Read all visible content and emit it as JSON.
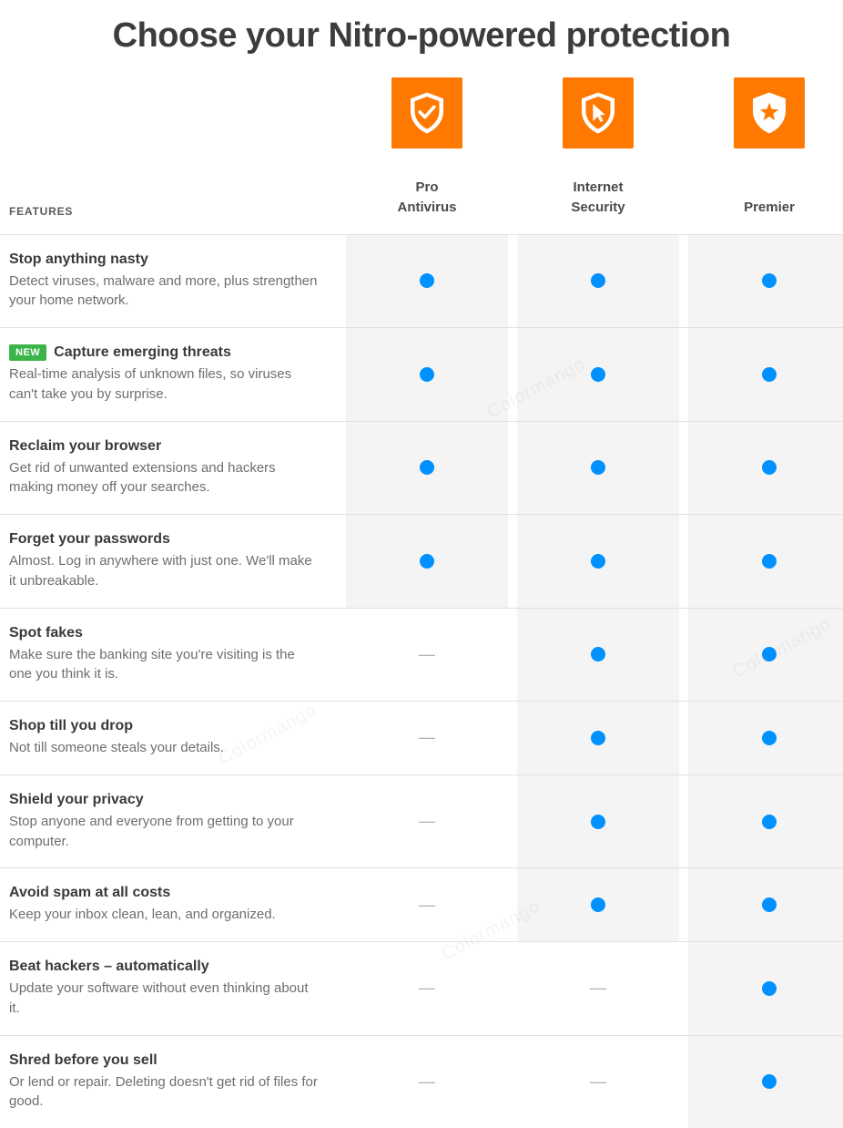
{
  "title": "Choose your Nitro-powered protection",
  "features_header": "FEATURES",
  "watermark_text": "Colormango",
  "new_badge": "NEW",
  "plans": [
    {
      "id": "pro",
      "name_line1": "Pro",
      "name_line2": "Antivirus",
      "icon": "shield-check"
    },
    {
      "id": "internet",
      "name_line1": "Internet",
      "name_line2": "Security",
      "icon": "shield-cursor"
    },
    {
      "id": "premier",
      "name_line1": "Premier",
      "name_line2": "",
      "icon": "shield-star"
    }
  ],
  "features": [
    {
      "title": "Stop anything nasty",
      "desc": "Detect viruses, malware and more, plus strengthen your home network.",
      "new": false,
      "included": [
        true,
        true,
        true
      ]
    },
    {
      "title": "Capture emerging threats",
      "desc": "Real-time analysis of unknown files, so viruses can't take you by surprise.",
      "new": true,
      "included": [
        true,
        true,
        true
      ]
    },
    {
      "title": "Reclaim your browser",
      "desc": "Get rid of unwanted extensions and hackers making money off your searches.",
      "new": false,
      "included": [
        true,
        true,
        true
      ]
    },
    {
      "title": "Forget your passwords",
      "desc": "Almost. Log in anywhere with just one. We'll make it unbreakable.",
      "new": false,
      "included": [
        true,
        true,
        true
      ]
    },
    {
      "title": "Spot fakes",
      "desc": "Make sure the banking site you're visiting is the one you think it is.",
      "new": false,
      "included": [
        false,
        true,
        true
      ]
    },
    {
      "title": "Shop till you drop",
      "desc": "Not till someone steals your details.",
      "new": false,
      "included": [
        false,
        true,
        true
      ]
    },
    {
      "title": "Shield your privacy",
      "desc": "Stop anyone and everyone from getting to your computer.",
      "new": false,
      "included": [
        false,
        true,
        true
      ]
    },
    {
      "title": "Avoid spam at all costs",
      "desc": "Keep your inbox clean, lean, and organized.",
      "new": false,
      "included": [
        false,
        true,
        true
      ]
    },
    {
      "title": "Beat hackers – automatically",
      "desc": "Update your software without even thinking about it.",
      "new": false,
      "included": [
        false,
        false,
        true
      ]
    },
    {
      "title": "Shred before you sell",
      "desc": "Or lend or repair. Deleting doesn't get rid of files for good.",
      "new": false,
      "included": [
        false,
        false,
        true
      ]
    }
  ]
}
